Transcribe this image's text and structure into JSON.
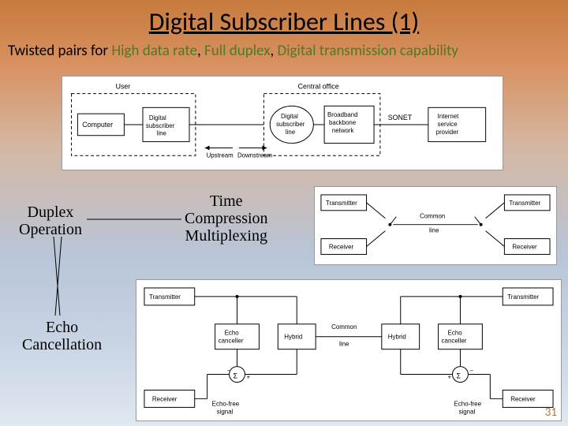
{
  "title": "Digital Subscriber Lines (1)",
  "subtitle_prefix": "Twisted pairs for ",
  "subtitle_green1": "High data rate",
  "subtitle_sep1": ", ",
  "subtitle_green2": "Full duplex",
  "subtitle_sep2": ", ",
  "subtitle_green3": "Digital transmission capability",
  "labels": {
    "duplex_l1": "Duplex",
    "duplex_l2": "Operation",
    "tcm_l1": "Time",
    "tcm_l2": "Compression",
    "tcm_l3": "Multiplexing",
    "echo_l1": "Echo",
    "echo_l2": "Cancellation"
  },
  "diagram_top": {
    "user": "User",
    "computer": "Computer",
    "dsl": "Digital subscriber line",
    "central": "Central office",
    "dsl2": "Digital subscriber line",
    "backbone": "Broadband backbone network",
    "sonet": "SONET",
    "isp": "Internet service provider",
    "upstream": "Upstream",
    "downstream": "Downstream"
  },
  "diagram_tcm": {
    "transmitter": "Transmitter",
    "receiver": "Receiver",
    "common": "Common line"
  },
  "diagram_echo": {
    "transmitter": "Transmitter",
    "echo_canceller": "Echo canceller",
    "hybrid": "Hybrid",
    "common": "Common line",
    "receiver": "Receiver",
    "echo_free": "Echo-free signal"
  },
  "page_number": "31"
}
